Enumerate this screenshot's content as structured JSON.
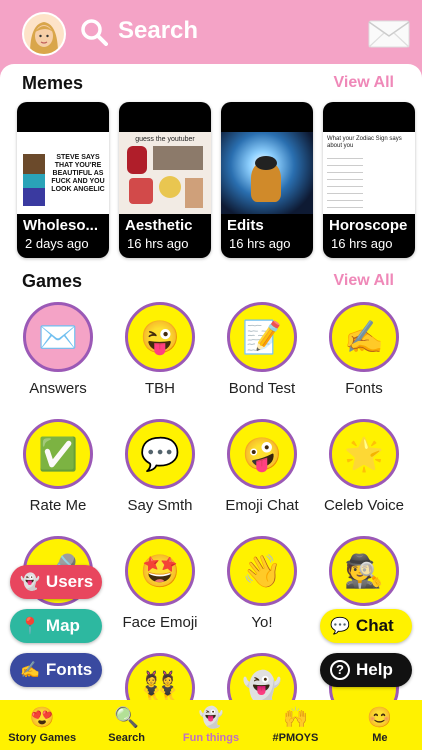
{
  "header": {
    "search_label": "Search",
    "avatar_icon": "bitmoji-avatar",
    "mail_icon": "envelope-icon"
  },
  "memes": {
    "title": "Memes",
    "view_all": "View All",
    "cards": [
      {
        "title": "Wholeso...",
        "time": "2 days ago",
        "image_text": "STEVE SAYS THAT YOU'RE BEAUTIFUL AS FUCK AND YOU LOOK ANGELIC"
      },
      {
        "title": "Aesthetic",
        "time": "16 hrs ago",
        "image_text": "guess the youtuber"
      },
      {
        "title": "Edits",
        "time": "16 hrs ago",
        "image_text": ""
      },
      {
        "title": "Horoscope",
        "time": "16 hrs ago",
        "image_text": "What your Zodiac Sign says about you"
      }
    ]
  },
  "games": {
    "title": "Games",
    "view_all": "View All",
    "items": [
      {
        "label": "Answers",
        "icon": "✉️"
      },
      {
        "label": "TBH",
        "icon": "😜"
      },
      {
        "label": "Bond Test",
        "icon": "📝"
      },
      {
        "label": "Fonts",
        "icon": "✍️"
      },
      {
        "label": "Rate Me",
        "icon": "✅"
      },
      {
        "label": "Say Smth",
        "icon": "💬"
      },
      {
        "label": "Emoji Chat",
        "icon": "🤪"
      },
      {
        "label": "Celeb Voice",
        "icon": "🌟"
      },
      {
        "label": "",
        "icon": "🎤"
      },
      {
        "label": "Face Emoji",
        "icon": "🤩"
      },
      {
        "label": "Yo!",
        "icon": "👋"
      },
      {
        "label": "",
        "icon": "🕵️"
      },
      {
        "label": "",
        "icon": "👯"
      },
      {
        "label": "",
        "icon": "👻"
      }
    ]
  },
  "floating": {
    "users": "Users",
    "map": "Map",
    "fonts": "Fonts",
    "chat": "Chat",
    "help": "Help"
  },
  "tabs": [
    {
      "label": "Story Games",
      "icon": "😍"
    },
    {
      "label": "Search",
      "icon": "🔍"
    },
    {
      "label": "Fun things",
      "icon": "👻"
    },
    {
      "label": "#PMOYS",
      "icon": "🙌"
    },
    {
      "label": "Me",
      "icon": "😊"
    }
  ],
  "colors": {
    "brand_pink": "#f4a3c6",
    "accent_yellow": "#fff200",
    "ring_purple": "#9b59b6",
    "view_all_pink": "#ef88b8"
  }
}
